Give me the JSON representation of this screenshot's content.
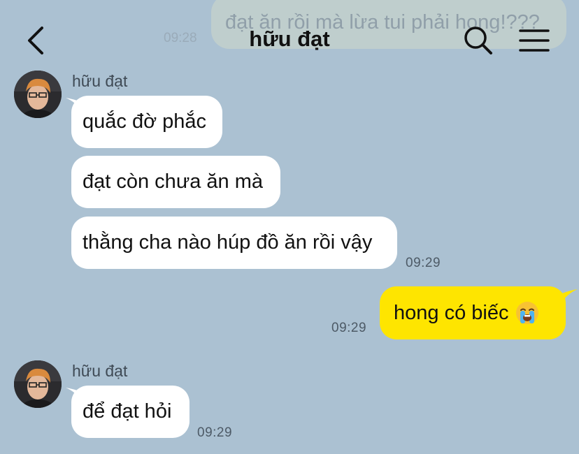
{
  "ghost": {
    "text": "đạt ăn rồi mà lừa tui phải hong!???",
    "time": "09:28"
  },
  "header": {
    "title": "hữu đạt",
    "back_icon": "chevron-left-icon",
    "search_icon": "search-icon",
    "menu_icon": "hamburger-menu-icon"
  },
  "messages": [
    {
      "sender": "hữu đạt",
      "bubbles": [
        "quắc đờ phắc",
        "đạt còn chưa ăn mà",
        "thằng cha nào húp đồ ăn rồi vậy"
      ],
      "time": "09:29"
    },
    {
      "mine": true,
      "text": "hong có biếc",
      "emoji": "loudly-crying-face",
      "time": "09:29"
    },
    {
      "sender": "hữu đạt",
      "bubbles": [
        "để đạt hỏi"
      ],
      "time": "09:29"
    }
  ],
  "colors": {
    "background": "#abc1d2",
    "incoming_bubble": "#ffffff",
    "outgoing_bubble": "#fee500"
  }
}
